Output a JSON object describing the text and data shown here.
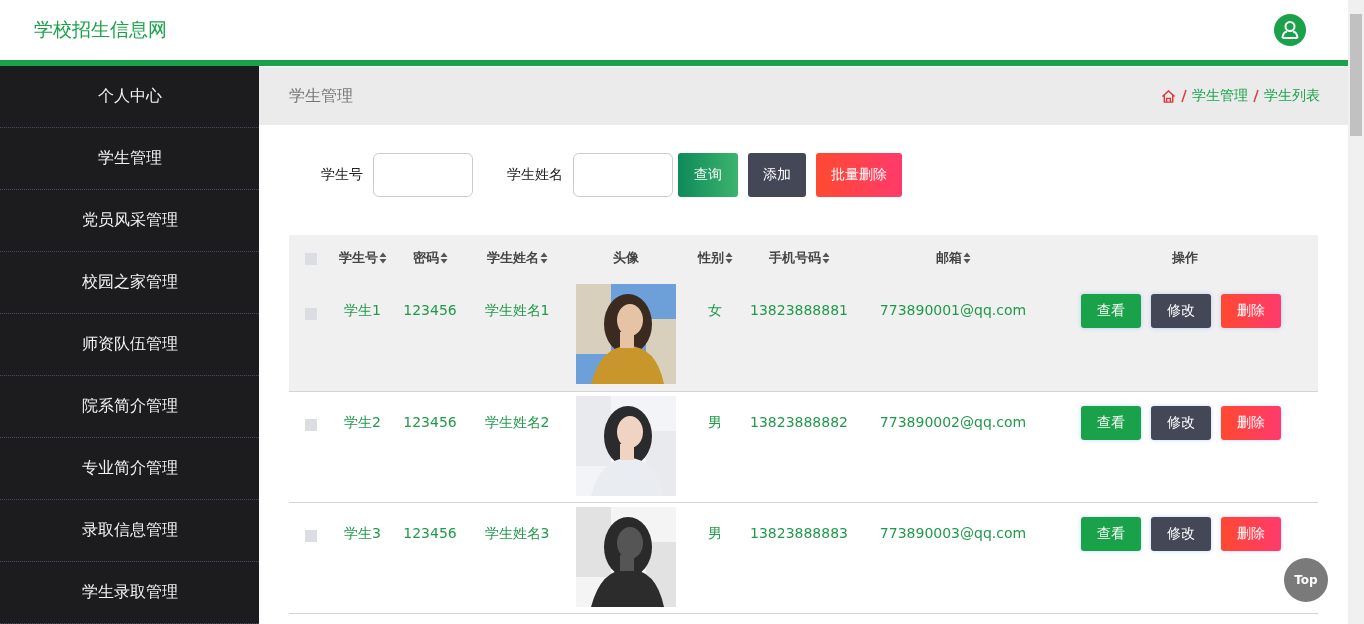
{
  "header": {
    "site_title": "学校招生信息网"
  },
  "sidebar": {
    "items": [
      {
        "label": "个人中心"
      },
      {
        "label": "学生管理"
      },
      {
        "label": "党员风采管理"
      },
      {
        "label": "校园之家管理"
      },
      {
        "label": "师资队伍管理"
      },
      {
        "label": "院系简介管理"
      },
      {
        "label": "专业简介管理"
      },
      {
        "label": "录取信息管理"
      },
      {
        "label": "学生录取管理"
      }
    ]
  },
  "page_title": "学生管理",
  "breadcrumb": [
    "学生管理",
    "学生列表"
  ],
  "search": {
    "fields": [
      {
        "label": "学生号"
      },
      {
        "label": "学生姓名"
      }
    ],
    "buttons": [
      {
        "label": "查询",
        "kind": "search"
      },
      {
        "label": "添加",
        "kind": "add"
      },
      {
        "label": "批量删除",
        "kind": "delete"
      }
    ]
  },
  "table": {
    "all_checked": false,
    "columns": [
      {
        "label": "学生号",
        "sortable": true
      },
      {
        "label": "密码",
        "sortable": true
      },
      {
        "label": "学生姓名",
        "sortable": true
      },
      {
        "label": "头像",
        "sortable": false
      },
      {
        "label": "性别",
        "sortable": true
      },
      {
        "label": "手机号码",
        "sortable": true
      },
      {
        "label": "邮箱",
        "sortable": true
      },
      {
        "label": "操作",
        "sortable": false
      }
    ],
    "rows": [
      {
        "checked": false,
        "highlighted": true,
        "student_no": "学生1",
        "password": "123456",
        "name": "学生姓名1",
        "gender": "女",
        "phone": "13823888881",
        "email": "773890001@qq.com",
        "actions": [
          {
            "label": "查看",
            "kind": "view"
          },
          {
            "label": "修改",
            "kind": "edit"
          },
          {
            "label": "删除",
            "kind": "delete"
          }
        ]
      },
      {
        "checked": false,
        "highlighted": false,
        "student_no": "学生2",
        "password": "123456",
        "name": "学生姓名2",
        "gender": "男",
        "phone": "13823888882",
        "email": "773890002@qq.com",
        "actions": [
          {
            "label": "查看",
            "kind": "view"
          },
          {
            "label": "修改",
            "kind": "edit"
          },
          {
            "label": "删除",
            "kind": "delete"
          }
        ]
      },
      {
        "checked": false,
        "highlighted": false,
        "student_no": "学生3",
        "password": "123456",
        "name": "学生姓名3",
        "gender": "男",
        "phone": "13823888883",
        "email": "773890003@qq.com",
        "actions": [
          {
            "label": "查看",
            "kind": "view"
          },
          {
            "label": "修改",
            "kind": "edit"
          },
          {
            "label": "删除",
            "kind": "delete"
          }
        ]
      }
    ]
  },
  "back_to_top": "Top"
}
